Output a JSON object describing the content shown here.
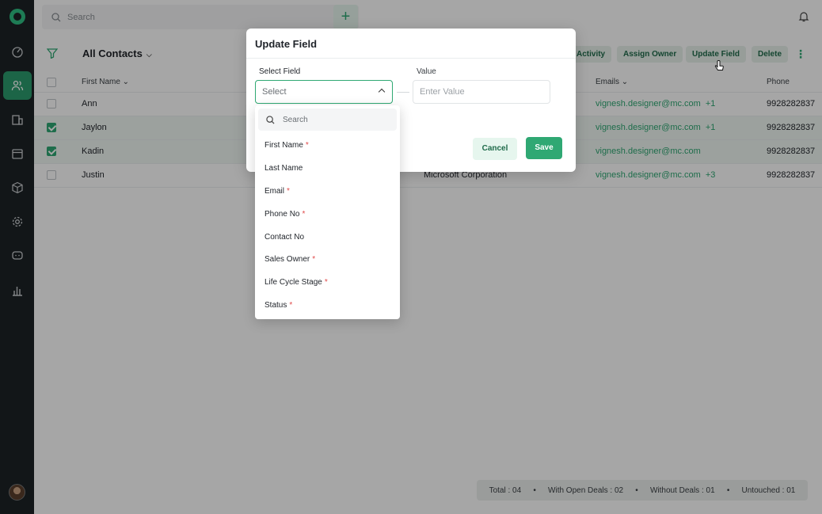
{
  "sidebar": {
    "items": [
      {
        "name": "dashboard"
      },
      {
        "name": "contacts",
        "active": true
      },
      {
        "name": "companies"
      },
      {
        "name": "calendar"
      },
      {
        "name": "products"
      },
      {
        "name": "settings"
      },
      {
        "name": "support"
      },
      {
        "name": "reports"
      }
    ]
  },
  "topbar": {
    "search_placeholder": "Search",
    "add_label": "+"
  },
  "toolbar": {
    "view_title": "All Contacts",
    "actions": [
      "Activity",
      "Assign Owner",
      "Update Field",
      "Delete"
    ]
  },
  "table": {
    "headers": [
      "First Name",
      "Emails",
      "Phone"
    ],
    "rows": [
      {
        "first_name": "Ann",
        "company": "",
        "email": "vignesh.designer@mc.com",
        "extra": "+1",
        "phone": "9928282837",
        "selected": false
      },
      {
        "first_name": "Jaylon",
        "company": "",
        "email": "vignesh.designer@mc.com",
        "extra": "+1",
        "phone": "9928282837",
        "selected": true
      },
      {
        "first_name": "Kadin",
        "company": "",
        "email": "vignesh.designer@mc.com",
        "extra": "",
        "phone": "9928282837",
        "selected": true
      },
      {
        "first_name": "Justin",
        "company": "Microsoft Corporation",
        "email": "vignesh.designer@mc.com",
        "extra": "+3",
        "phone": "9928282837",
        "selected": false
      }
    ]
  },
  "summary": {
    "total": "Total : 04",
    "open_deals": "With Open Deals : 02",
    "without_deals": "Without Deals : 01",
    "untouched": "Untouched : 01"
  },
  "modal": {
    "title": "Update Field",
    "select_label": "Select Field",
    "select_value": "Select",
    "value_label": "Value",
    "value_placeholder": "Enter Value",
    "cancel_label": "Cancel",
    "save_label": "Save"
  },
  "dropdown": {
    "search_placeholder": "Search",
    "options": [
      {
        "label": "First Name",
        "required": true
      },
      {
        "label": "Last Name",
        "required": false
      },
      {
        "label": "Email",
        "required": true
      },
      {
        "label": "Phone No",
        "required": true
      },
      {
        "label": "Contact No",
        "required": false
      },
      {
        "label": "Sales Owner",
        "required": true
      },
      {
        "label": "Life Cycle Stage",
        "required": true
      },
      {
        "label": "Status",
        "required": true
      }
    ]
  },
  "colors": {
    "brand": "#2fa873",
    "sidebar": "#1d2326",
    "required": "#e04a4a"
  }
}
